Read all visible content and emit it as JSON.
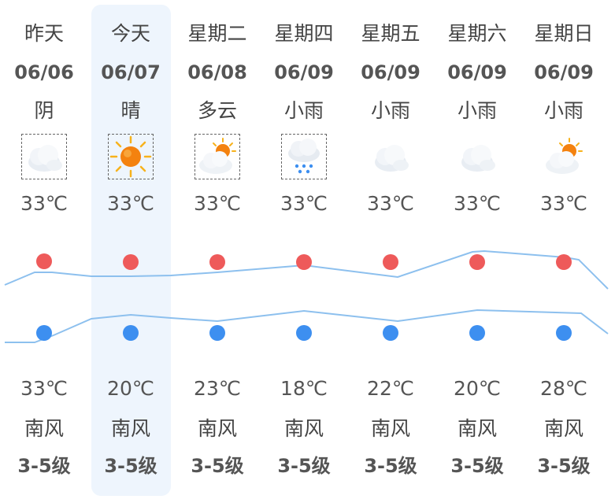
{
  "forecast": {
    "days": [
      {
        "name": "昨天",
        "date": "06/06",
        "condition": "阴",
        "icon": "cloudy-icon",
        "top_temp": "33℃",
        "low_temp": "33℃",
        "wind_dir": "南风",
        "wind_level": "3-5级"
      },
      {
        "name": "今天",
        "date": "06/07",
        "condition": "晴",
        "icon": "sunny-icon",
        "top_temp": "33℃",
        "low_temp": "20℃",
        "wind_dir": "南风",
        "wind_level": "3-5级"
      },
      {
        "name": "星期二",
        "date": "06/08",
        "condition": "多云",
        "icon": "partly-cloudy-icon",
        "top_temp": "33℃",
        "low_temp": "23℃",
        "wind_dir": "南风",
        "wind_level": "3-5级"
      },
      {
        "name": "星期四",
        "date": "06/09",
        "condition": "小雨",
        "icon": "rain-icon",
        "top_temp": "33℃",
        "low_temp": "18℃",
        "wind_dir": "南风",
        "wind_level": "3-5级"
      },
      {
        "name": "星期五",
        "date": "06/09",
        "condition": "小雨",
        "icon": "cloudy-icon",
        "top_temp": "33℃",
        "low_temp": "22℃",
        "wind_dir": "南风",
        "wind_level": "3-5级"
      },
      {
        "name": "星期六",
        "date": "06/09",
        "condition": "小雨",
        "icon": "cloudy-icon",
        "top_temp": "33℃",
        "low_temp": "20℃",
        "wind_dir": "南风",
        "wind_level": "3-5级"
      },
      {
        "name": "星期日",
        "date": "06/09",
        "condition": "小雨",
        "icon": "partly-cloudy-icon",
        "top_temp": "33℃",
        "low_temp": "28℃",
        "wind_dir": "南风",
        "wind_level": "3-5级"
      }
    ],
    "colors": {
      "high_dot": "#ee5a5a",
      "low_dot": "#3d8ff0",
      "line": "#8dc0ee",
      "today_bg": "#eef5fd"
    }
  }
}
